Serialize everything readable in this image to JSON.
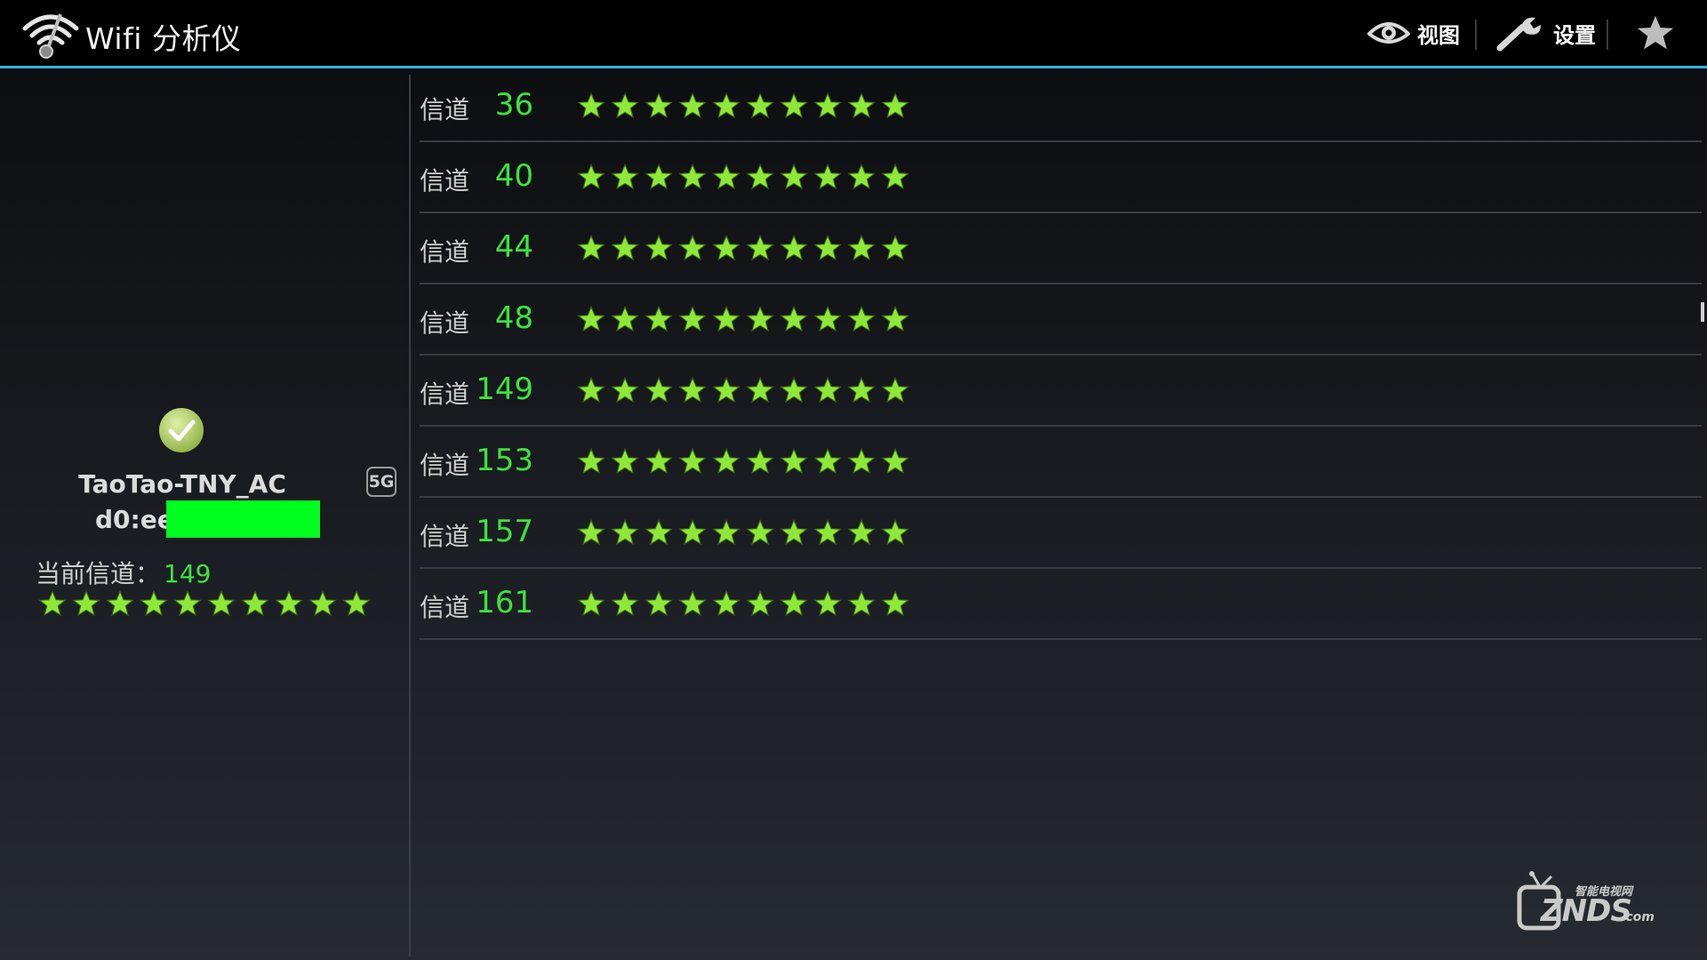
{
  "app": {
    "title": "Wifi 分析仪",
    "icon": "wifi-analyzer-icon"
  },
  "actionbar": {
    "view_label": "视图",
    "settings_label": "设置",
    "view_icon": "eye-icon",
    "settings_icon": "wrench-icon",
    "favorite_icon": "star-icon"
  },
  "colors": {
    "accent": "#33b5e5",
    "channel_number": "#3ee23e",
    "star": "#8ee83a",
    "mac_redaction": "#00ff1e"
  },
  "connected_ap": {
    "status_icon": "check-circle-icon",
    "ssid": "TaoTao-TNY_AC",
    "band_badge": "5G",
    "mac_visible": "d0:ee:",
    "current_channel_label": "当前信道：",
    "current_channel": "149",
    "rating_stars": 10
  },
  "channels": [
    {
      "label": "信道",
      "number": "36",
      "stars": 10
    },
    {
      "label": "信道",
      "number": "40",
      "stars": 10
    },
    {
      "label": "信道",
      "number": "44",
      "stars": 10
    },
    {
      "label": "信道",
      "number": "48",
      "stars": 10
    },
    {
      "label": "信道",
      "number": "149",
      "stars": 10
    },
    {
      "label": "信道",
      "number": "153",
      "stars": 10
    },
    {
      "label": "信道",
      "number": "157",
      "stars": 10
    },
    {
      "label": "信道",
      "number": "161",
      "stars": 10
    }
  ],
  "watermark": {
    "brand": "ZNDS",
    "domain": ".com",
    "tagline": "智能电视网"
  }
}
